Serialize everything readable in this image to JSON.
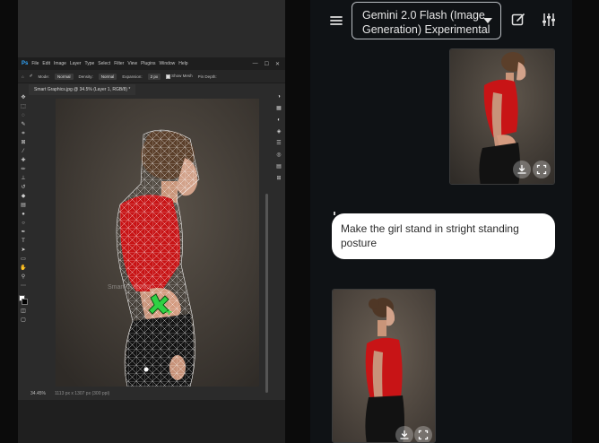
{
  "photoshop": {
    "logo": "Ps",
    "menu": [
      "File",
      "Edit",
      "Image",
      "Layer",
      "Type",
      "Select",
      "Filter",
      "View",
      "Plugins",
      "Window",
      "Help"
    ],
    "window_controls": [
      "—",
      "☐",
      "✕"
    ],
    "options": {
      "mode_label": "Mode:",
      "mode_value": "Normal",
      "density_label": "Density:",
      "density_value": "Normal",
      "expansion_label": "Expansion:",
      "expansion_value": "2 px",
      "show_mesh_label": "Show Mesh",
      "pin_depth_label": "Pin Depth:"
    },
    "doc_tab": "Smart Graphics.jpg @ 34.5% (Layer 1, RGB/8) *",
    "status": {
      "zoom": "34.45%",
      "doc_size": "1113 px x 1307 px (300 ppi)"
    },
    "watermark": "Smart Graphics",
    "warp_cursor": "+"
  },
  "gemini": {
    "model": {
      "line1": "Gemini 2.0 Flash (Image",
      "line2": "Generation) Experimental"
    },
    "user_prompt": {
      "line1": "Make the girl stand in stright standing",
      "line2": "posture"
    },
    "icons": [
      "menu-icon",
      "edit-icon",
      "tune-icon",
      "download-icon",
      "fullscreen-icon"
    ]
  },
  "colors": {
    "ps_bg": "#2b2b2b",
    "ps_accent": "#31a8ff",
    "gemini_bg": "#0f1215",
    "shirt_red": "#c81416",
    "mesh_green": "#33e04a"
  }
}
